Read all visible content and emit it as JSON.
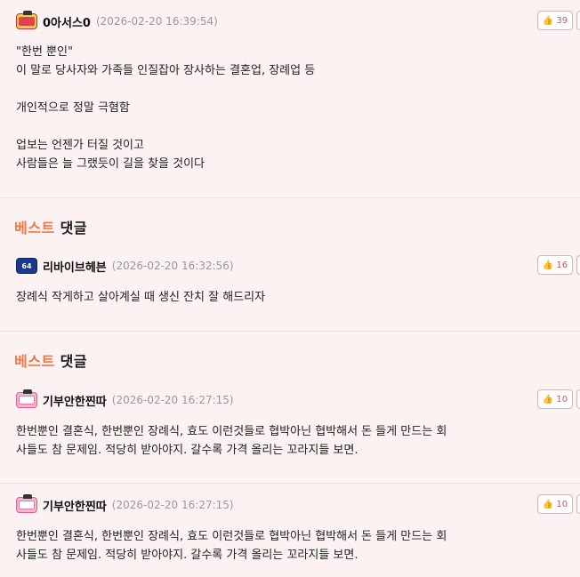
{
  "comments": [
    {
      "nickname": "0아서스0",
      "date": "(2026-02-20 16:39:54)",
      "likes": "39",
      "body": "\"한번 뿐인\"\n이 말로 당사자와 가족들 인질잡아 장사하는 결혼업, 장례업 등\n\n개인적으로 정말 극혐함\n\n업보는 언젠가 터질 것이고\n사람들은 늘 그랬듯이 길을 찾을 것이다"
    },
    {
      "best_label_a": "베스트",
      "best_label_b": "댓글",
      "nickname": "리바이브헤븐",
      "date": "(2026-02-20 16:32:56)",
      "likes": "16",
      "level": "64",
      "body": "장례식 작게하고 살아계실 때 생신 잔치 잘 해드리자"
    },
    {
      "best_label_a": "베스트",
      "best_label_b": "댓글",
      "nickname": "기부안한찐따",
      "date": "(2026-02-20 16:27:15)",
      "likes": "10",
      "body": "한번뿐인 결혼식, 한번뿐인 장례식, 효도 이런것들로 협박아닌 협박해서 돈 들게 만드는 회\n사들도 참 문제임. 적당히 받아야지. 갈수록 가격 올리는 꼬라지들 보면."
    },
    {
      "nickname": "기부안한찐따",
      "date": "(2026-02-20 16:27:15)",
      "likes": "10",
      "body": "한번뿐인 결혼식, 한번뿐인 장례식, 효도 이런것들로 협박아닌 협박해서 돈 들게 만드는 회\n사들도 참 문제임. 적당히 받아야지. 갈수록 가격 올리는 꼬라지들 보면."
    }
  ],
  "colors": {
    "best_accent": "#f07844",
    "like_text": "#c85a5a",
    "background": "#fdf2f2"
  }
}
